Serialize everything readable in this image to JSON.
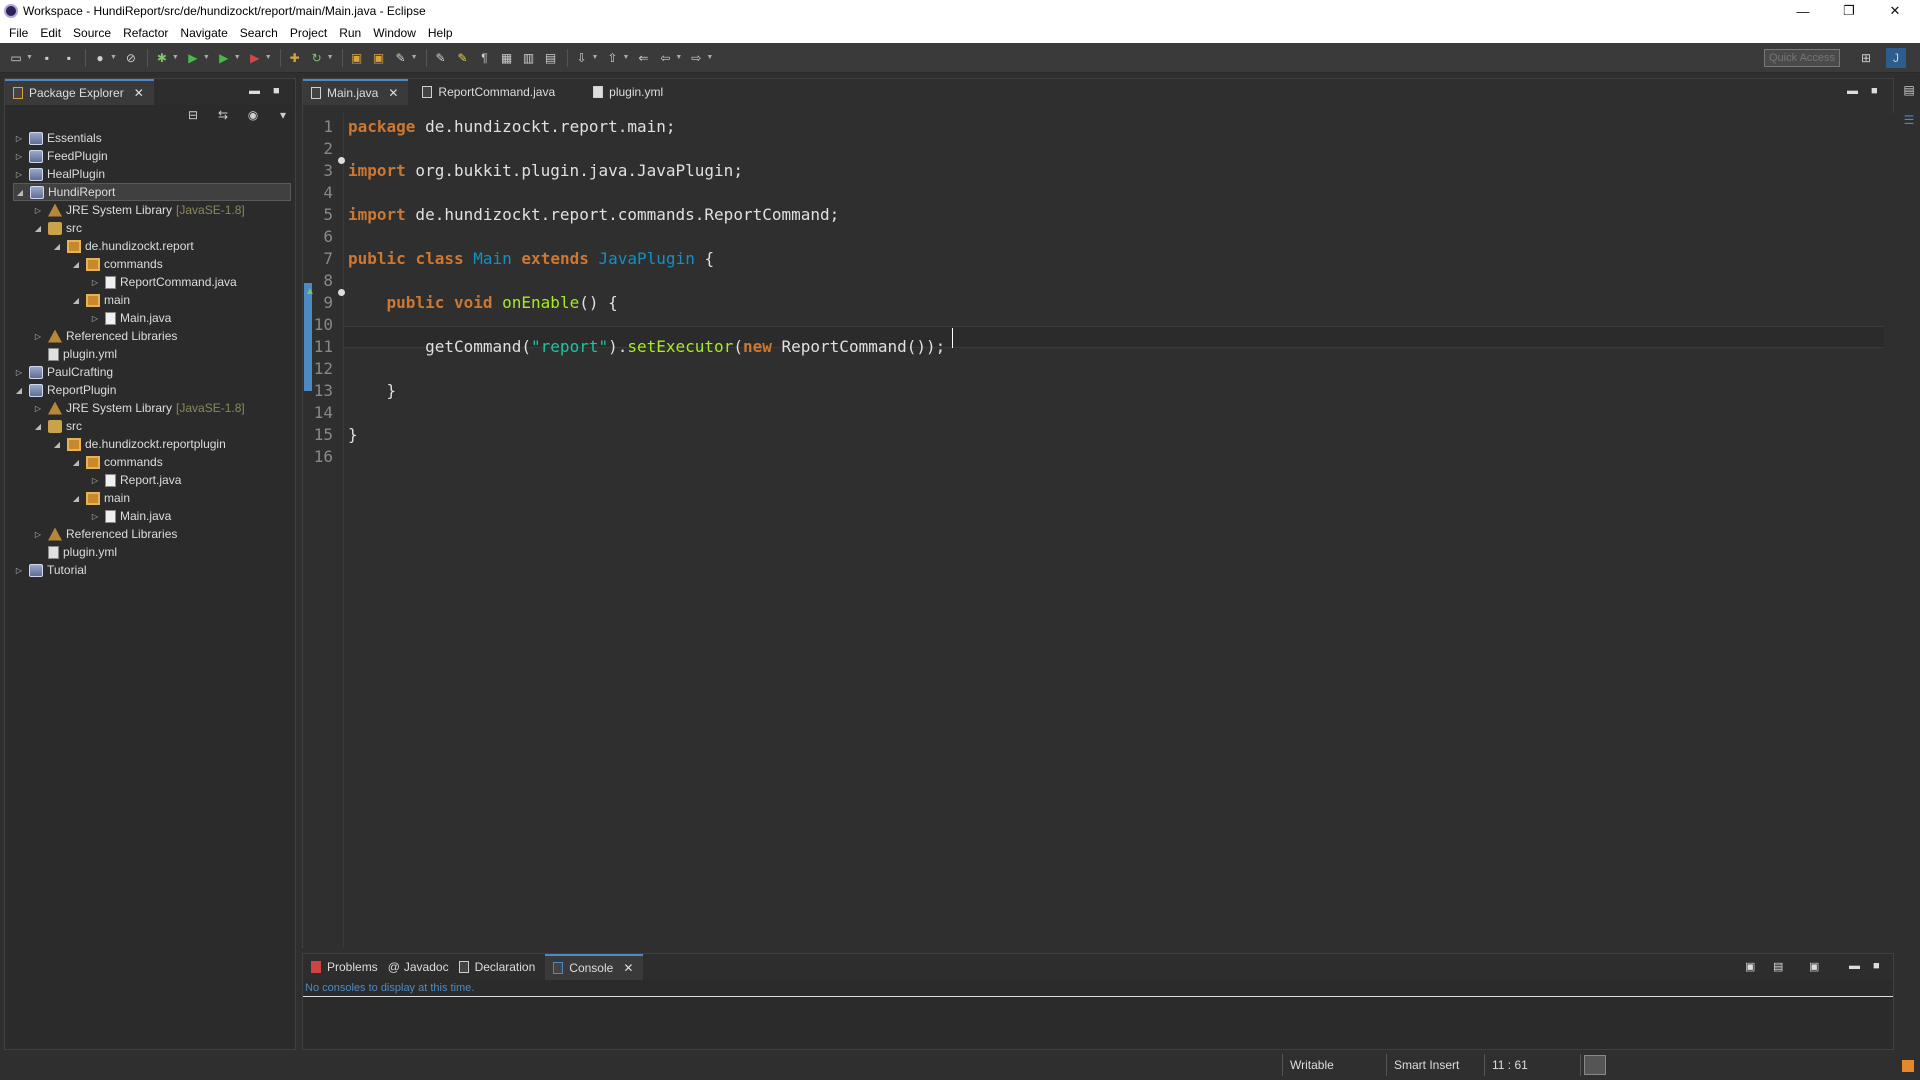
{
  "window": {
    "title": "Workspace - HundiReport/src/de/hundizockt/report/main/Main.java - Eclipse",
    "controls": [
      "—",
      "❐",
      "✕"
    ]
  },
  "menu": [
    "File",
    "Edit",
    "Source",
    "Refactor",
    "Navigate",
    "Search",
    "Project",
    "Run",
    "Window",
    "Help"
  ],
  "toolbar": {
    "quick_access_placeholder": "Quick Access"
  },
  "package_explorer": {
    "title": "Package Explorer",
    "tree": [
      {
        "label": "Essentials",
        "type": "project",
        "twisty": "▷",
        "level": 0
      },
      {
        "label": "FeedPlugin",
        "type": "project",
        "twisty": "▷",
        "level": 0
      },
      {
        "label": "HealPlugin",
        "type": "project",
        "twisty": "▷",
        "level": 0
      },
      {
        "label": "HundiReport",
        "type": "project",
        "twisty": "◢",
        "level": 0,
        "selected": true
      },
      {
        "label": "JRE System Library",
        "suffix": "[JavaSE-1.8]",
        "type": "lib",
        "twisty": "▷",
        "level": 1
      },
      {
        "label": "src",
        "type": "src",
        "twisty": "◢",
        "level": 1
      },
      {
        "label": "de.hundizockt.report",
        "type": "pkg",
        "twisty": "◢",
        "level": 2
      },
      {
        "label": "commands",
        "type": "pkg",
        "twisty": "◢",
        "level": 3
      },
      {
        "label": "ReportCommand.java",
        "type": "java",
        "twisty": "▷",
        "level": 4
      },
      {
        "label": "main",
        "type": "pkg",
        "twisty": "◢",
        "level": 3
      },
      {
        "label": "Main.java",
        "type": "java",
        "twisty": "▷",
        "level": 4
      },
      {
        "label": "Referenced Libraries",
        "type": "lib",
        "twisty": "▷",
        "level": 1
      },
      {
        "label": "plugin.yml",
        "type": "yml",
        "twisty": "",
        "level": 1
      },
      {
        "label": "PaulCrafting",
        "type": "project",
        "twisty": "▷",
        "level": 0
      },
      {
        "label": "ReportPlugin",
        "type": "project",
        "twisty": "◢",
        "level": 0
      },
      {
        "label": "JRE System Library",
        "suffix": "[JavaSE-1.8]",
        "type": "lib",
        "twisty": "▷",
        "level": 1
      },
      {
        "label": "src",
        "type": "src",
        "twisty": "◢",
        "level": 1
      },
      {
        "label": "de.hundizockt.reportplugin",
        "type": "pkg",
        "twisty": "◢",
        "level": 2
      },
      {
        "label": "commands",
        "type": "pkg",
        "twisty": "◢",
        "level": 3
      },
      {
        "label": "Report.java",
        "type": "java",
        "twisty": "▷",
        "level": 4
      },
      {
        "label": "main",
        "type": "pkg",
        "twisty": "◢",
        "level": 3
      },
      {
        "label": "Main.java",
        "type": "java",
        "twisty": "▷",
        "level": 4
      },
      {
        "label": "Referenced Libraries",
        "type": "lib",
        "twisty": "▷",
        "level": 1
      },
      {
        "label": "plugin.yml",
        "type": "yml",
        "twisty": "",
        "level": 1
      },
      {
        "label": "Tutorial",
        "type": "project",
        "twisty": "▷",
        "level": 0
      }
    ]
  },
  "editor": {
    "tabs": [
      {
        "label": "Main.java",
        "active": true,
        "closable": true
      },
      {
        "label": "ReportCommand.java",
        "active": false,
        "closable": false
      },
      {
        "label": "plugin.yml",
        "active": false,
        "closable": false
      }
    ],
    "line_numbers": [
      "1",
      "2",
      "3",
      "4",
      "5",
      "6",
      "7",
      "8",
      "9",
      "10",
      "11",
      "12",
      "13",
      "14",
      "15",
      "16"
    ],
    "lines": [
      [
        {
          "t": "package",
          "c": "kw"
        },
        {
          "t": " de.hundizockt.report.main;",
          "c": ""
        }
      ],
      [],
      [
        {
          "t": "import",
          "c": "kw"
        },
        {
          "t": " org.bukkit.plugin.java.JavaPlugin;",
          "c": ""
        }
      ],
      [],
      [
        {
          "t": "import",
          "c": "kw"
        },
        {
          "t": " de.hundizockt.report.commands.ReportCommand;",
          "c": ""
        }
      ],
      [],
      [
        {
          "t": "public",
          "c": "kw"
        },
        {
          "t": " ",
          "c": ""
        },
        {
          "t": "class",
          "c": "kw"
        },
        {
          "t": " ",
          "c": ""
        },
        {
          "t": "Main",
          "c": "cn"
        },
        {
          "t": " ",
          "c": ""
        },
        {
          "t": "extends",
          "c": "kw"
        },
        {
          "t": " ",
          "c": ""
        },
        {
          "t": "JavaPlugin",
          "c": "cn"
        },
        {
          "t": " {",
          "c": ""
        }
      ],
      [],
      [
        {
          "t": "    ",
          "c": ""
        },
        {
          "t": "public",
          "c": "kw"
        },
        {
          "t": " ",
          "c": ""
        },
        {
          "t": "void",
          "c": "kw"
        },
        {
          "t": " ",
          "c": ""
        },
        {
          "t": "onEnable",
          "c": "mt"
        },
        {
          "t": "() {",
          "c": ""
        }
      ],
      [],
      [
        {
          "t": "        getCommand(",
          "c": ""
        },
        {
          "t": "\"report\"",
          "c": "st"
        },
        {
          "t": ").",
          "c": ""
        },
        {
          "t": "setExecutor",
          "c": "mt"
        },
        {
          "t": "(",
          "c": ""
        },
        {
          "t": "new",
          "c": "kw"
        },
        {
          "t": " ReportCommand());",
          "c": ""
        }
      ],
      [],
      [
        {
          "t": "    }",
          "c": ""
        }
      ],
      [],
      [
        {
          "t": "}",
          "c": ""
        }
      ],
      []
    ]
  },
  "bottom": {
    "tabs": [
      "Problems",
      "Javadoc",
      "Declaration",
      "Console"
    ],
    "active_tab": "Console",
    "message": "No consoles to display at this time."
  },
  "status": {
    "mode": "Writable",
    "insert": "Smart Insert",
    "position": "11 : 61"
  }
}
